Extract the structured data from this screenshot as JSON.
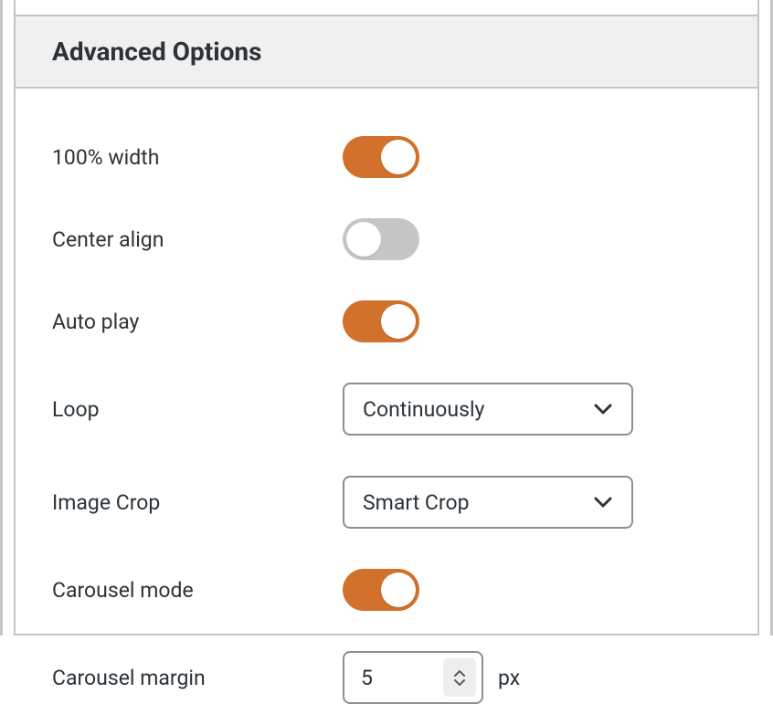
{
  "section": {
    "title": "Advanced Options"
  },
  "fields": {
    "full_width": {
      "label": "100% width",
      "value": true
    },
    "center_align": {
      "label": "Center align",
      "value": false
    },
    "auto_play": {
      "label": "Auto play",
      "value": true
    },
    "loop": {
      "label": "Loop",
      "value": "Continuously"
    },
    "image_crop": {
      "label": "Image Crop",
      "value": "Smart Crop"
    },
    "carousel_mode": {
      "label": "Carousel mode",
      "value": true
    },
    "carousel_margin": {
      "label": "Carousel margin",
      "value": "5",
      "unit": "px"
    }
  },
  "colors": {
    "accent": "#d1712b",
    "toggle_off": "#c6c6c6",
    "border": "#8c8f94"
  }
}
